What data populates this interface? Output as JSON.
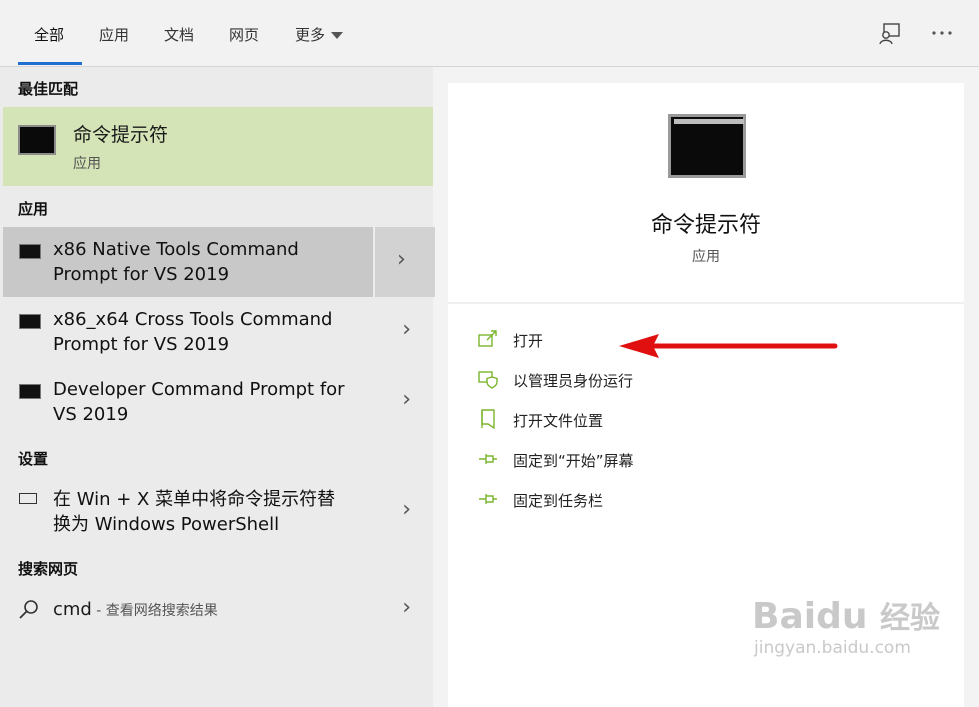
{
  "tabs": [
    {
      "label": "全部",
      "active": true
    },
    {
      "label": "应用"
    },
    {
      "label": "文档"
    },
    {
      "label": "网页"
    },
    {
      "label": "更多"
    }
  ],
  "header_icons": [
    "feedback-icon",
    "more-options-icon"
  ],
  "accent_color": "#1e6fd0",
  "selection_color": "#d4e4b6",
  "sections": {
    "best_match": "最佳匹配",
    "apps": "应用",
    "settings": "设置",
    "web": "搜索网页"
  },
  "best_match": {
    "title": "命令提示符",
    "subtitle": "应用"
  },
  "apps": [
    {
      "line1": "x86 Native Tools Command",
      "line2": "Prompt for VS 2019"
    },
    {
      "line1": "x86_x64 Cross Tools Command",
      "line2": "Prompt for VS 2019"
    },
    {
      "line1": "Developer Command Prompt for",
      "line2": "VS 2019"
    }
  ],
  "settings_item": {
    "line1": "在 Win + X 菜单中将命令提示符替",
    "line2": "换为 Windows PowerShell"
  },
  "web_item": {
    "query": "cmd",
    "hint": " - 查看网络搜索结果"
  },
  "detail": {
    "title": "命令提示符",
    "subtitle": "应用",
    "actions": [
      {
        "label": "打开",
        "icon": "open-icon"
      },
      {
        "label": "以管理员身份运行",
        "icon": "shield-icon"
      },
      {
        "label": "打开文件位置",
        "icon": "folder-location-icon"
      },
      {
        "label": "固定到“开始”屏幕",
        "icon": "pin-icon"
      },
      {
        "label": "固定到任务栏",
        "icon": "pin-icon"
      }
    ]
  },
  "watermark": {
    "brand": "Baidu",
    "brand_cn": "经验",
    "url": "jingyan.baidu.com"
  }
}
